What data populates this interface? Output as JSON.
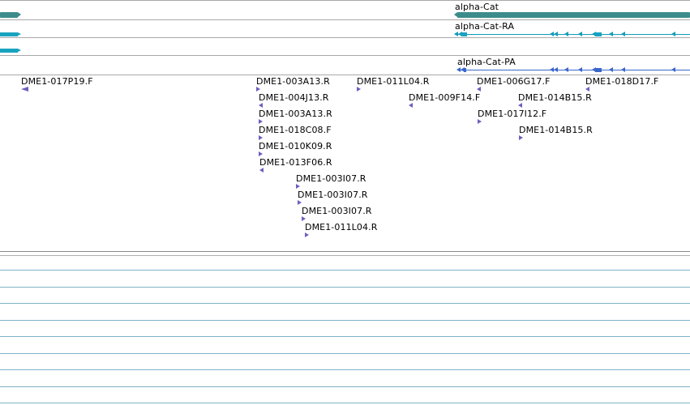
{
  "colors": {
    "gene": "#3d8c8c",
    "transcript": "#139bbb",
    "protein": "#3a67c9",
    "est": "#6f5fbf"
  },
  "genes": {
    "gene_label": "alpha-Cat",
    "transcript_label": "alpha-Cat-RA",
    "protein_label": "alpha-Cat-PA"
  },
  "est_labels": [
    "DME1-017P19.F",
    "DME1-003A13.R",
    "DME1-004J13.R",
    "DME1-003A13.R",
    "DME1-018C08.F",
    "DME1-010K09.R",
    "DME1-013F06.R",
    "DME1-003I07.R",
    "DME1-003I07.R",
    "DME1-003I07.R",
    "DME1-011L04.R",
    "DME1-011L04.R",
    "DME1-009F14.F",
    "DME1-006G17.F",
    "DME1-017I12.F",
    "DME1-014B15.R",
    "DME1-014B15.R",
    "DME1-018D17.F"
  ]
}
